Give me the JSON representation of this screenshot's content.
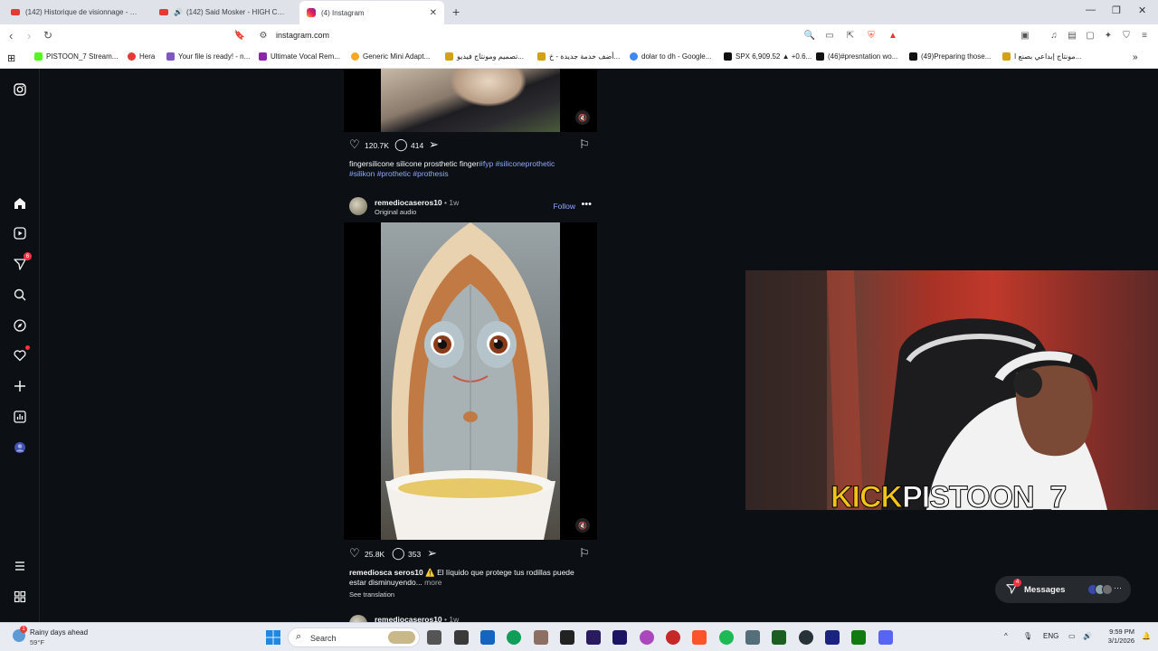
{
  "browser": {
    "tabs": [
      {
        "title": "(142) Historique de visionnage - YouT",
        "active": false
      },
      {
        "title": "(142) Said Mosker - HIGH CLASS",
        "active": false
      },
      {
        "title": "(4) Instagram",
        "active": true
      }
    ],
    "url": "instagram.com",
    "bookmarks": [
      "PISTOON_7 Stream...",
      "Hera",
      "Your file is ready! - n...",
      "Ultimate Vocal Rem...",
      "Generic Mini Adapt...",
      "تصميم ومونتاج فيديو...",
      "أضف خدمة جديدة - خ...",
      "dolar to dh - Google...",
      "SPX 6,909.52 ▲ +0.6...",
      "(46)#presntation wo...",
      "(49)Preparing those...",
      "مونتاج إبداعي بصنع ا..."
    ]
  },
  "sidebar": {
    "notifications_badge": "6"
  },
  "post1": {
    "likes": "120.7K",
    "comments": "414",
    "caption_text": "fingersilicone silicone prosthetic finger",
    "caption_tags_line1": "#fyp #siliconeprothetic",
    "caption_tags_line2": "#silikon #prothetic #prothesis"
  },
  "post2": {
    "username": "remediocaseros10",
    "time": "• 1w",
    "audio": "Original audio",
    "follow": "Follow",
    "likes": "25.8K",
    "comments": "353",
    "caption_user": "remediosca seros10",
    "caption_text": "⚠️ El líquido que protege tus rodillas puede",
    "caption_line2": "estar disminuyendo...",
    "more": "more",
    "see_translation": "See translation"
  },
  "post3": {
    "username": "remediocaseros10",
    "time": "• 1w"
  },
  "stream_overlay": {
    "kick_word": "KICK",
    "channel": "PISTOON_7"
  },
  "messages": {
    "label": "Messages",
    "badge": "4"
  },
  "taskbar": {
    "weather_title": "Rainy days ahead",
    "weather_temp": "59°F",
    "weather_badge": "1",
    "search_label": "Search",
    "lang": "ENG",
    "time": "9:59 PM",
    "date": "3/1/2026"
  },
  "colors": {
    "ig_bg": "#0c1014",
    "link_blue": "#8fa8ff",
    "kick_yellow": "#f2c318",
    "badge_red": "#ff3040"
  }
}
